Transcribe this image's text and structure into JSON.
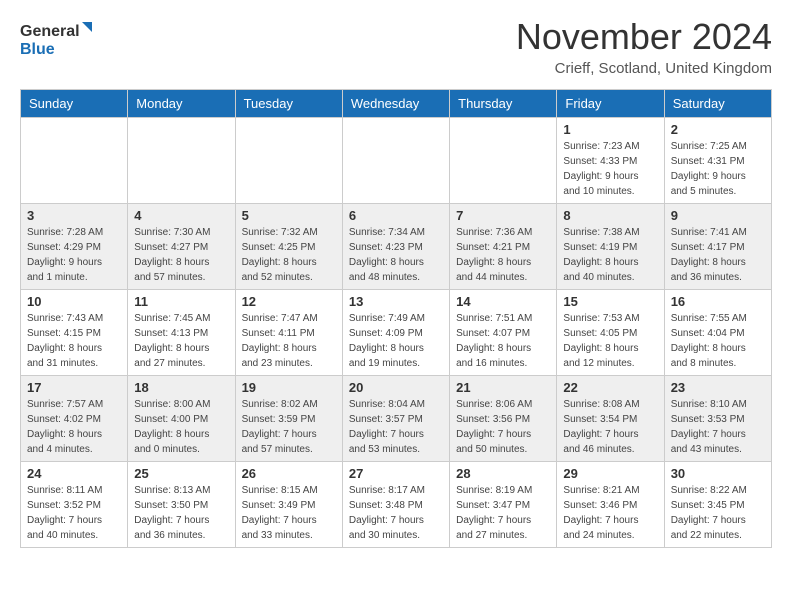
{
  "logo": {
    "line1": "General",
    "line2": "Blue"
  },
  "title": "November 2024",
  "subtitle": "Crieff, Scotland, United Kingdom",
  "headers": [
    "Sunday",
    "Monday",
    "Tuesday",
    "Wednesday",
    "Thursday",
    "Friday",
    "Saturday"
  ],
  "weeks": [
    [
      {
        "num": "",
        "info": ""
      },
      {
        "num": "",
        "info": ""
      },
      {
        "num": "",
        "info": ""
      },
      {
        "num": "",
        "info": ""
      },
      {
        "num": "",
        "info": ""
      },
      {
        "num": "1",
        "info": "Sunrise: 7:23 AM\nSunset: 4:33 PM\nDaylight: 9 hours and 10 minutes."
      },
      {
        "num": "2",
        "info": "Sunrise: 7:25 AM\nSunset: 4:31 PM\nDaylight: 9 hours and 5 minutes."
      }
    ],
    [
      {
        "num": "3",
        "info": "Sunrise: 7:28 AM\nSunset: 4:29 PM\nDaylight: 9 hours and 1 minute."
      },
      {
        "num": "4",
        "info": "Sunrise: 7:30 AM\nSunset: 4:27 PM\nDaylight: 8 hours and 57 minutes."
      },
      {
        "num": "5",
        "info": "Sunrise: 7:32 AM\nSunset: 4:25 PM\nDaylight: 8 hours and 52 minutes."
      },
      {
        "num": "6",
        "info": "Sunrise: 7:34 AM\nSunset: 4:23 PM\nDaylight: 8 hours and 48 minutes."
      },
      {
        "num": "7",
        "info": "Sunrise: 7:36 AM\nSunset: 4:21 PM\nDaylight: 8 hours and 44 minutes."
      },
      {
        "num": "8",
        "info": "Sunrise: 7:38 AM\nSunset: 4:19 PM\nDaylight: 8 hours and 40 minutes."
      },
      {
        "num": "9",
        "info": "Sunrise: 7:41 AM\nSunset: 4:17 PM\nDaylight: 8 hours and 36 minutes."
      }
    ],
    [
      {
        "num": "10",
        "info": "Sunrise: 7:43 AM\nSunset: 4:15 PM\nDaylight: 8 hours and 31 minutes."
      },
      {
        "num": "11",
        "info": "Sunrise: 7:45 AM\nSunset: 4:13 PM\nDaylight: 8 hours and 27 minutes."
      },
      {
        "num": "12",
        "info": "Sunrise: 7:47 AM\nSunset: 4:11 PM\nDaylight: 8 hours and 23 minutes."
      },
      {
        "num": "13",
        "info": "Sunrise: 7:49 AM\nSunset: 4:09 PM\nDaylight: 8 hours and 19 minutes."
      },
      {
        "num": "14",
        "info": "Sunrise: 7:51 AM\nSunset: 4:07 PM\nDaylight: 8 hours and 16 minutes."
      },
      {
        "num": "15",
        "info": "Sunrise: 7:53 AM\nSunset: 4:05 PM\nDaylight: 8 hours and 12 minutes."
      },
      {
        "num": "16",
        "info": "Sunrise: 7:55 AM\nSunset: 4:04 PM\nDaylight: 8 hours and 8 minutes."
      }
    ],
    [
      {
        "num": "17",
        "info": "Sunrise: 7:57 AM\nSunset: 4:02 PM\nDaylight: 8 hours and 4 minutes."
      },
      {
        "num": "18",
        "info": "Sunrise: 8:00 AM\nSunset: 4:00 PM\nDaylight: 8 hours and 0 minutes."
      },
      {
        "num": "19",
        "info": "Sunrise: 8:02 AM\nSunset: 3:59 PM\nDaylight: 7 hours and 57 minutes."
      },
      {
        "num": "20",
        "info": "Sunrise: 8:04 AM\nSunset: 3:57 PM\nDaylight: 7 hours and 53 minutes."
      },
      {
        "num": "21",
        "info": "Sunrise: 8:06 AM\nSunset: 3:56 PM\nDaylight: 7 hours and 50 minutes."
      },
      {
        "num": "22",
        "info": "Sunrise: 8:08 AM\nSunset: 3:54 PM\nDaylight: 7 hours and 46 minutes."
      },
      {
        "num": "23",
        "info": "Sunrise: 8:10 AM\nSunset: 3:53 PM\nDaylight: 7 hours and 43 minutes."
      }
    ],
    [
      {
        "num": "24",
        "info": "Sunrise: 8:11 AM\nSunset: 3:52 PM\nDaylight: 7 hours and 40 minutes."
      },
      {
        "num": "25",
        "info": "Sunrise: 8:13 AM\nSunset: 3:50 PM\nDaylight: 7 hours and 36 minutes."
      },
      {
        "num": "26",
        "info": "Sunrise: 8:15 AM\nSunset: 3:49 PM\nDaylight: 7 hours and 33 minutes."
      },
      {
        "num": "27",
        "info": "Sunrise: 8:17 AM\nSunset: 3:48 PM\nDaylight: 7 hours and 30 minutes."
      },
      {
        "num": "28",
        "info": "Sunrise: 8:19 AM\nSunset: 3:47 PM\nDaylight: 7 hours and 27 minutes."
      },
      {
        "num": "29",
        "info": "Sunrise: 8:21 AM\nSunset: 3:46 PM\nDaylight: 7 hours and 24 minutes."
      },
      {
        "num": "30",
        "info": "Sunrise: 8:22 AM\nSunset: 3:45 PM\nDaylight: 7 hours and 22 minutes."
      }
    ]
  ]
}
